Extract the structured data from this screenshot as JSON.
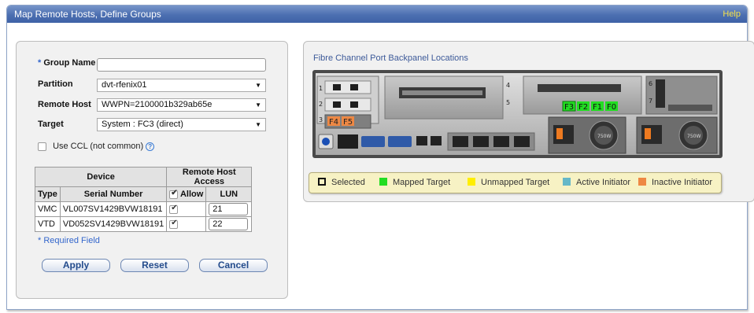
{
  "window": {
    "title": "Map Remote Hosts, Define Groups",
    "help_label": "Help"
  },
  "form": {
    "group_name": {
      "label": "Group Name",
      "required_marker": "*",
      "value": ""
    },
    "partition": {
      "label": "Partition",
      "value": "dvt-rfenix01"
    },
    "remote_host": {
      "label": "Remote Host",
      "value": "WWPN=2100001b329ab65e"
    },
    "target": {
      "label": "Target",
      "value": "System : FC3 (direct)"
    },
    "use_ccl": {
      "label": "Use CCL (not common)",
      "checked": false
    }
  },
  "device_table": {
    "group_headers": {
      "device": "Device",
      "remote_access": "Remote Host Access"
    },
    "columns": {
      "type": "Type",
      "serial": "Serial Number",
      "allow": "Allow",
      "lun": "LUN"
    },
    "rows": [
      {
        "type": "VMC",
        "serial": "VL007SV1429BVW18191",
        "allow": true,
        "lun": "21"
      },
      {
        "type": "VTD",
        "serial": "VD052SV1429BVW18191",
        "allow": true,
        "lun": "22"
      }
    ]
  },
  "required_note": "* Required Field",
  "buttons": {
    "apply": "Apply",
    "reset": "Reset",
    "cancel": "Cancel"
  },
  "backpanel": {
    "title": "Fibre Channel Port Backpanel Locations",
    "ports_mapped": [
      "F3",
      "F2",
      "F1",
      "F0"
    ],
    "ports_inactive": [
      "F4",
      "F5"
    ],
    "psu_labels": [
      "750W",
      "750W"
    ],
    "slot_numbers": [
      "1",
      "2",
      "3",
      "4",
      "5",
      "6",
      "7"
    ]
  },
  "legend": [
    {
      "label": "Selected",
      "color": "#111111",
      "style": "outline"
    },
    {
      "label": "Mapped Target",
      "color": "#22dd22",
      "style": "fill"
    },
    {
      "label": "Unmapped Target",
      "color": "#ffee00",
      "style": "fill"
    },
    {
      "label": "Active Initiator",
      "color": "#66b8c8",
      "style": "fill"
    },
    {
      "label": "Inactive Initiator",
      "color": "#ee8844",
      "style": "fill"
    }
  ]
}
